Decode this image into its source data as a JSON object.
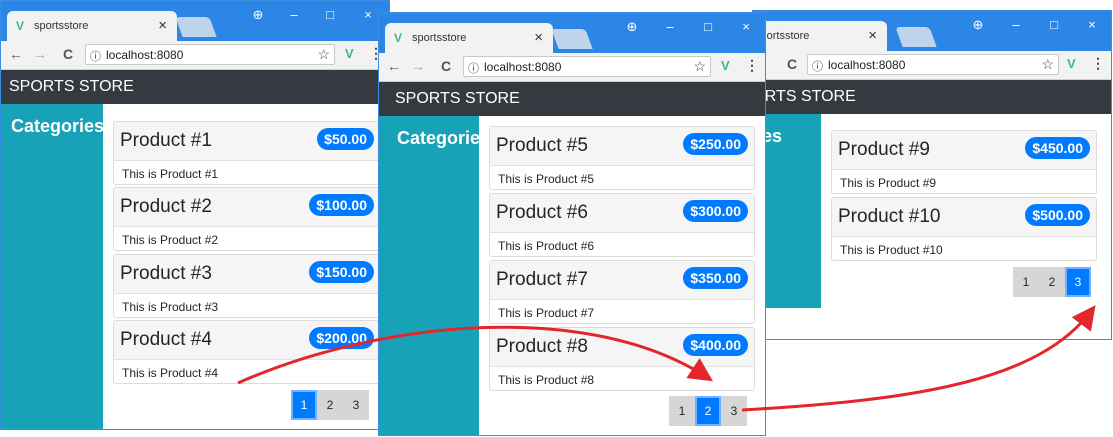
{
  "browser": {
    "tab_title": "sportsstore",
    "address": "localhost:8080",
    "info_icon": "ⓘ",
    "close_glyph": "×",
    "controls": {
      "account": "⊕",
      "minimize": "–",
      "maximize": "□",
      "close": "×"
    },
    "nav": {
      "back": "←",
      "forward": "→",
      "reload": "C",
      "star": "☆",
      "vue": "V",
      "menu": "⋮"
    }
  },
  "store": {
    "brand": "SPORTS STORE",
    "categories_label": "Categories"
  },
  "windows": [
    {
      "products": [
        {
          "name": "Product #1",
          "price": "$50.00",
          "description": "This is Product #1"
        },
        {
          "name": "Product #2",
          "price": "$100.00",
          "description": "This is Product #2"
        },
        {
          "name": "Product #3",
          "price": "$150.00",
          "description": "This is Product #3"
        },
        {
          "name": "Product #4",
          "price": "$200.00",
          "description": "This is Product #4"
        }
      ],
      "pages": [
        "1",
        "2",
        "3"
      ],
      "current_page": 1
    },
    {
      "products": [
        {
          "name": "Product #5",
          "price": "$250.00",
          "description": "This is Product #5"
        },
        {
          "name": "Product #6",
          "price": "$300.00",
          "description": "This is Product #6"
        },
        {
          "name": "Product #7",
          "price": "$350.00",
          "description": "This is Product #7"
        },
        {
          "name": "Product #8",
          "price": "$400.00",
          "description": "This is Product #8"
        }
      ],
      "pages": [
        "1",
        "2",
        "3"
      ],
      "current_page": 2
    },
    {
      "products": [
        {
          "name": "Product #9",
          "price": "$450.00",
          "description": "This is Product #9"
        },
        {
          "name": "Product #10",
          "price": "$500.00",
          "description": "This is Product #10"
        }
      ],
      "pages": [
        "1",
        "2",
        "3"
      ],
      "current_page": 3
    }
  ],
  "colors": {
    "titlebar": "#2b86e5",
    "navbar": "#343a40",
    "sidebar": "#17a2b8",
    "price_badge": "#007bff",
    "arrow": "#e3262b"
  }
}
